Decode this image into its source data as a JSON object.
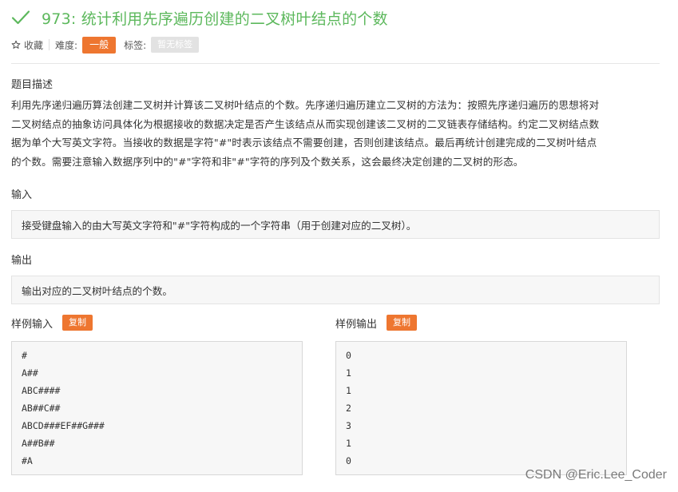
{
  "problem": {
    "title": "973: 统计利用先序遍历创建的二叉树叶结点的个数",
    "status_color": "#5cb85c"
  },
  "meta": {
    "favorite_label": "收藏",
    "difficulty_label": "难度:",
    "difficulty_value": "一般",
    "tags_label": "标签:",
    "tags_value": "暂无标签",
    "difficulty_color": "#ee7630"
  },
  "description": {
    "heading": "题目描述",
    "lines": [
      "利用先序递归遍历算法创建二叉树并计算该二叉树叶结点的个数。先序递归遍历建立二叉树的方法为：按照先序递归遍历的思想将对",
      "二叉树结点的抽象访问具体化为根据接收的数据决定是否产生该结点从而实现创建该二叉树的二叉链表存储结构。约定二叉树结点数",
      "据为单个大写英文字符。当接收的数据是字符\"#\"时表示该结点不需要创建，否则创建该结点。最后再统计创建完成的二叉树叶结点",
      "的个数。需要注意输入数据序列中的\"#\"字符和非\"#\"字符的序列及个数关系，这会最终决定创建的二叉树的形态。"
    ]
  },
  "input": {
    "heading": "输入",
    "text": "接受键盘输入的由大写英文字符和\"#\"字符构成的一个字符串（用于创建对应的二叉树）。"
  },
  "output": {
    "heading": "输出",
    "text": "输出对应的二叉树叶结点的个数。"
  },
  "sample_input": {
    "heading": "样例输入",
    "copy_label": "复制",
    "lines": [
      "#",
      "A##",
      "ABC####",
      "AB##C##",
      "ABCD###EF##G###",
      "A##B##",
      "#A"
    ]
  },
  "sample_output": {
    "heading": "样例输出",
    "copy_label": "复制",
    "lines": [
      "0",
      "1",
      "1",
      "2",
      "3",
      "1",
      "0"
    ]
  },
  "watermark": "CSDN @Eric.Lee_Coder"
}
